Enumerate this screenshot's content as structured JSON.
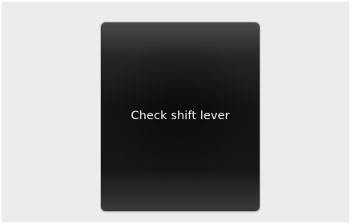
{
  "display": {
    "message": "Check shift lever"
  }
}
